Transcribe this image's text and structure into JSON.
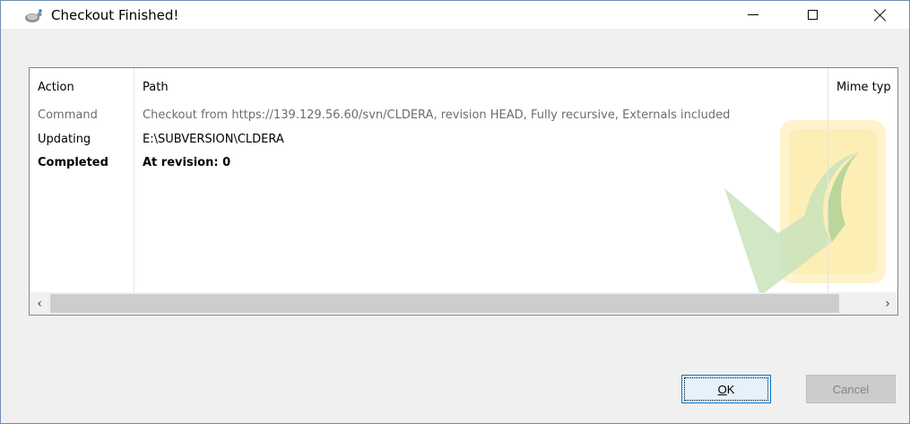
{
  "window": {
    "title": "Checkout Finished!",
    "title_icon": "tortoisesvn-icon"
  },
  "titlebar_buttons": {
    "minimize": "minimize-icon",
    "maximize": "maximize-icon",
    "close": "close-icon"
  },
  "list": {
    "columns": [
      "Action",
      "Path",
      "Mime typ"
    ],
    "rows": [
      {
        "action": "Command",
        "path": "Checkout from https://139.129.56.60/svn/CLDERA, revision HEAD, Fully recursive, Externals included",
        "style": "gray"
      },
      {
        "action": "Updating",
        "path": "E:\\SUBVERSION\\CLDERA",
        "style": "normal"
      },
      {
        "action": "Completed",
        "path": "At revision: 0",
        "style": "bold"
      }
    ],
    "watermark_icon": "checkmark-watermark-icon"
  },
  "scrollbar": {
    "left_arrow": "‹",
    "right_arrow": "›"
  },
  "buttons": {
    "ok_mnemonic": "O",
    "ok_rest": "K",
    "cancel": "Cancel"
  },
  "colors": {
    "frame_border": "#6f8fb3",
    "ok_border": "#0078d7",
    "ok_bg": "#e5f1fb",
    "cancel_bg": "#cccccc",
    "gray_text": "#6d6d6d"
  }
}
